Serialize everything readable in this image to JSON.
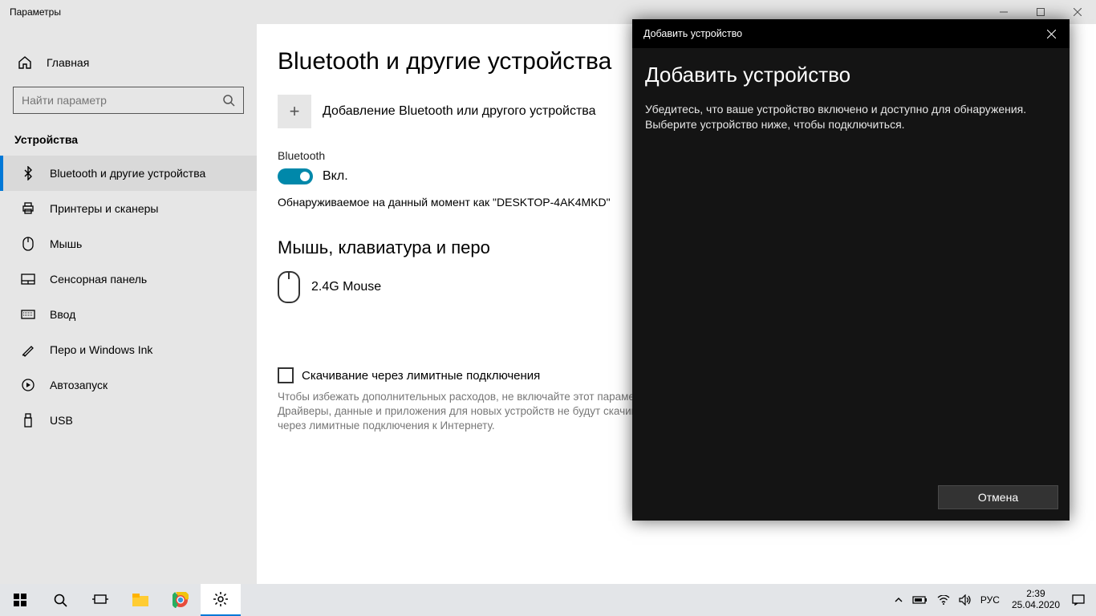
{
  "window": {
    "title": "Параметры"
  },
  "sidebar": {
    "home": "Главная",
    "search_placeholder": "Найти параметр",
    "category": "Устройства",
    "items": [
      {
        "label": "Bluetooth и другие устройства",
        "active": true
      },
      {
        "label": "Принтеры и сканеры"
      },
      {
        "label": "Мышь"
      },
      {
        "label": "Сенсорная панель"
      },
      {
        "label": "Ввод"
      },
      {
        "label": "Перо и Windows Ink"
      },
      {
        "label": "Автозапуск"
      },
      {
        "label": "USB"
      }
    ]
  },
  "main": {
    "heading": "Bluetooth и другие устройства",
    "add_device_label": "Добавление Bluetooth или другого устройства",
    "bluetooth_section_label": "Bluetooth",
    "toggle_state": "Вкл.",
    "discoverable_text": "Обнаруживаемое на данный момент как \"DESKTOP-4AK4MKD\"",
    "devices_heading": "Мышь, клавиатура и перо",
    "device_name": "2.4G Mouse",
    "metered_checkbox": "Скачивание через лимитные подключения",
    "metered_desc": "Чтобы избежать дополнительных расходов, не включайте этот параметр. Драйверы, данные и приложения для новых устройств не будут скачиваться через лимитные подключения к Интернету."
  },
  "modal": {
    "titlebar": "Добавить устройство",
    "heading": "Добавить устройство",
    "desc": "Убедитесь, что ваше устройство включено и доступно для обнаружения. Выберите устройство ниже, чтобы подключиться.",
    "cancel": "Отмена"
  },
  "taskbar": {
    "lang": "РУС",
    "time": "2:39",
    "date": "25.04.2020"
  }
}
